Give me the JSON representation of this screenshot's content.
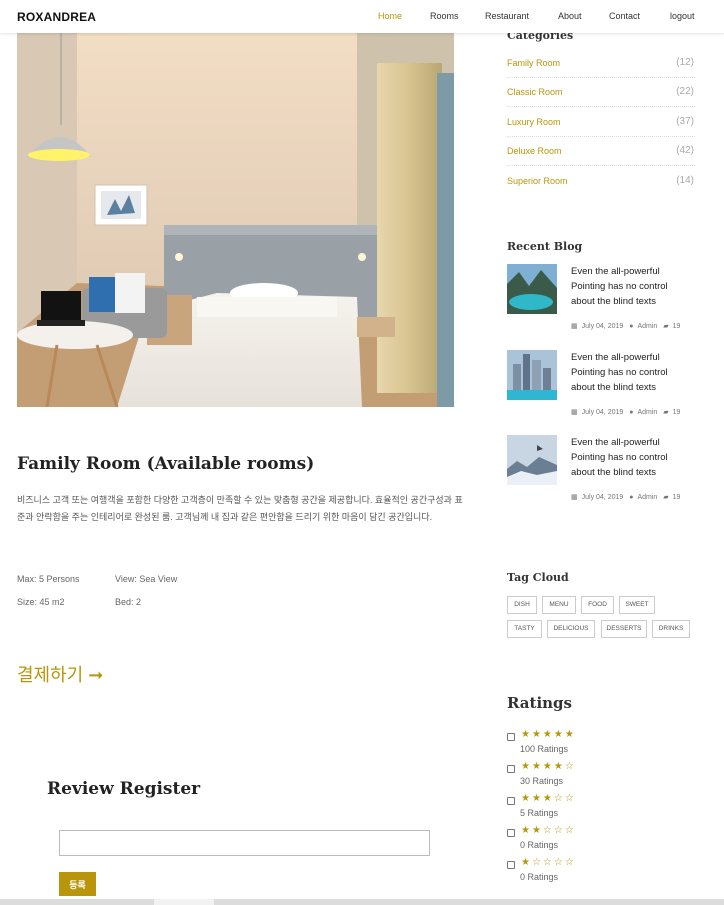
{
  "nav": {
    "brand": "ROXANDREA",
    "links": [
      "Home",
      "Rooms",
      "Restaurant",
      "About",
      "Contact",
      "logout"
    ]
  },
  "room": {
    "title": "Family Room (Available rooms)",
    "description": "비즈니스 고객 또는 여행객을 포함한 다양한 고객층이 만족할 수 있는 맞춤형 공간을 제공합니다. 효율적인 공간구성과 표준과 안락함을 주는 인테리어로 완성된 룸. 고객님께 내 집과 같은 편안함을 드리기 위한 마음이 담긴 공간입니다.",
    "max": "Max: 5 Persons",
    "view": "View: Sea View",
    "size": "Size: 45 m2",
    "bed": "Bed: 2"
  },
  "checkout": {
    "label": "결제하기",
    "arrow": "➞"
  },
  "review": {
    "title": "Review Register",
    "input_value": "",
    "button": "등록"
  },
  "sidebar": {
    "categories_title": "Categories",
    "categories": [
      {
        "name": "Family Room",
        "count": "(12)"
      },
      {
        "name": "Classic Room",
        "count": "(22)"
      },
      {
        "name": "Luxury Room",
        "count": "(37)"
      },
      {
        "name": "Deluxe Room",
        "count": "(42)"
      },
      {
        "name": "Superior Room",
        "count": "(14)"
      }
    ],
    "recent_title": "Recent Blog",
    "blogs": [
      {
        "title": "Even the all-powerful Pointing has no control about the blind texts",
        "date": "July 04, 2019",
        "author": "Admin",
        "comments": "19"
      },
      {
        "title": "Even the all-powerful Pointing has no control about the blind texts",
        "date": "July 04, 2019",
        "author": "Admin",
        "comments": "19"
      },
      {
        "title": "Even the all-powerful Pointing has no control about the blind texts",
        "date": "July 04, 2019",
        "author": "Admin",
        "comments": "19"
      }
    ],
    "tag_title": "Tag Cloud",
    "tags": [
      "DISH",
      "MENU",
      "FOOD",
      "SWEET",
      "TASTY",
      "DELICIOUS",
      "DESSERTS",
      "DRINKS"
    ],
    "ratings_title": "Ratings",
    "ratings": [
      {
        "stars": 5,
        "label": "100 Ratings"
      },
      {
        "stars": 4,
        "label": "30 Ratings"
      },
      {
        "stars": 3,
        "label": "5 Ratings"
      },
      {
        "stars": 2,
        "label": "0 Ratings"
      },
      {
        "stars": 1,
        "label": "0 Ratings"
      }
    ]
  },
  "colors": {
    "accent": "#b8950a",
    "text": "#333333",
    "muted": "#aaaaaa"
  }
}
